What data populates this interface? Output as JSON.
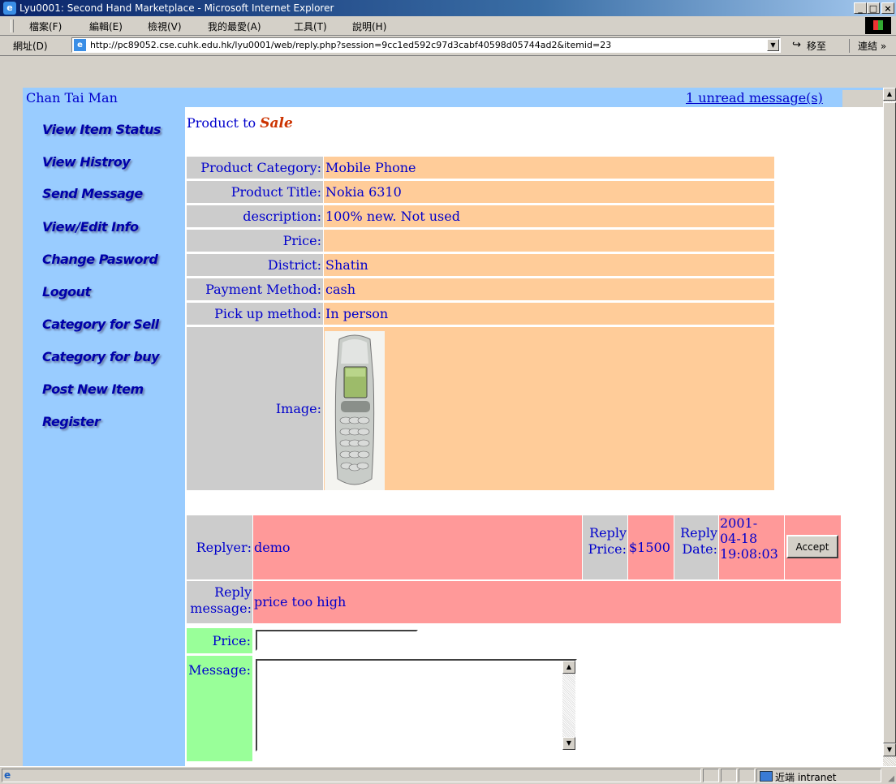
{
  "window": {
    "title": "Lyu0001: Second Hand Marketplace - Microsoft Internet Explorer",
    "controls": [
      "_",
      "□",
      "×"
    ]
  },
  "menu": [
    "檔案(F)",
    "編輯(E)",
    "檢視(V)",
    "我的最愛(A)",
    "工具(T)",
    "說明(H)"
  ],
  "address": {
    "label": "網址(D)",
    "url": "http://pc89052.cse.cuhk.edu.hk/lyu0001/web/reply.php?session=9cc1ed592c97d3cabf40598d05744ad2&itemid=23",
    "go_label": "移至",
    "links_label": "連結 »"
  },
  "header": {
    "username": "Chan Tai Man",
    "unread": "1 unread message(s)"
  },
  "sidebar": {
    "items": [
      {
        "label": "View Item Status"
      },
      {
        "label": "View Histroy"
      },
      {
        "label": "Send Message"
      },
      {
        "label": "View/Edit Info"
      },
      {
        "label": "Change Pasword"
      },
      {
        "label": "Logout"
      },
      {
        "label": "Category for Sell"
      },
      {
        "label": "Category for buy"
      },
      {
        "label": "Post New Item"
      },
      {
        "label": "Register"
      }
    ]
  },
  "product": {
    "heading_prefix": "Product to",
    "heading_type": "Sale",
    "rows": [
      {
        "label": "Product Category:",
        "value": "Mobile Phone"
      },
      {
        "label": "Product Title:",
        "value": "Nokia 6310"
      },
      {
        "label": "description:",
        "value": "100% new. Not used"
      },
      {
        "label": "Price:",
        "value": ""
      },
      {
        "label": "District:",
        "value": "Shatin"
      },
      {
        "label": "Payment Method:",
        "value": "cash"
      },
      {
        "label": "Pick up method:",
        "value": "In person"
      }
    ],
    "image_label": "Image:",
    "image_icon": "mobile-phone-photo"
  },
  "reply": {
    "replyer_label": "Replyer:",
    "replyer": "demo",
    "price_label_1": "Reply",
    "price_label_2": "Price:",
    "price": "$1500",
    "date_label_1": "Reply",
    "date_label_2": "Date:",
    "date_1": "2001-",
    "date_2": "04-18",
    "date_3": "19:08:03",
    "accept_label": "Accept",
    "message_label_1": "Reply",
    "message_label_2": "message:",
    "message": "price too high"
  },
  "form": {
    "price_label": "Price:",
    "price_value": "",
    "message_label": "Message:",
    "message_value": ""
  },
  "status": {
    "zone": "近端 intranet"
  },
  "colors": {
    "sidebar": "#99ccff",
    "label_cell": "#cccccc",
    "value_cell": "#ffcc99",
    "reply_cell": "#ff9999",
    "form_label": "#99ff99",
    "text": "#0000cc",
    "sale": "#cc3300"
  }
}
